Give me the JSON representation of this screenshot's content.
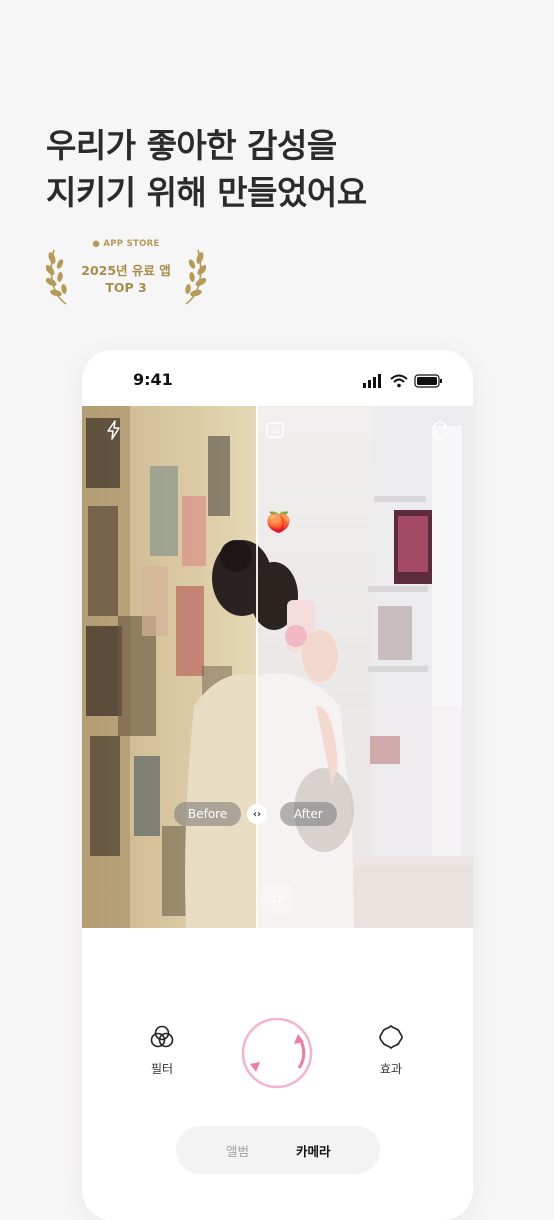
{
  "headline": {
    "line1": "우리가 좋아한 감성을",
    "line2": "지키기 위해 만들었어요"
  },
  "award": {
    "store": "APP STORE",
    "title": "2025년 유료 앱",
    "rank": "TOP 3",
    "color": "#b59a58"
  },
  "phone": {
    "status": {
      "time": "9:41",
      "icons": [
        "signal-icon",
        "wifi-icon",
        "battery-icon"
      ]
    },
    "preview": {
      "before_label": "Before",
      "after_label": "After",
      "zoom_label": "1x",
      "top_icons": [
        "flash-icon",
        "timer-icon",
        "switch-camera-icon"
      ],
      "sticker": "🍑"
    },
    "controls": {
      "filter_label": "필터",
      "effect_label": "효과",
      "shutter_color": "#f5b3cf"
    },
    "modes": {
      "album": "앨범",
      "camera": "카메라"
    }
  }
}
